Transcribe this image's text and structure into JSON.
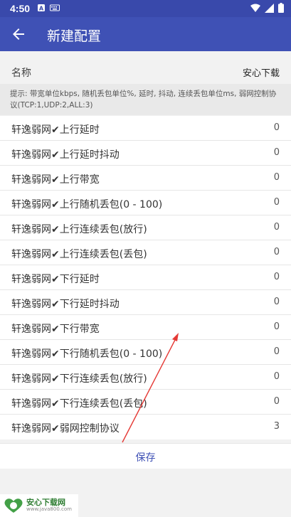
{
  "status": {
    "time": "4:50"
  },
  "appbar": {
    "title": "新建配置"
  },
  "name_row": {
    "label": "名称",
    "value": "安心下载"
  },
  "hint": "提示: 带宽单位kbps, 随机丢包单位%, 延时, 抖动, 连续丢包单位ms, 弱网控制协议(TCP:1,UDP:2,ALL:3)",
  "items": [
    {
      "label": "轩逸弱网✔上行延时",
      "value": "0"
    },
    {
      "label": "轩逸弱网✔上行延时抖动",
      "value": "0"
    },
    {
      "label": "轩逸弱网✔上行带宽",
      "value": "0"
    },
    {
      "label": "轩逸弱网✔上行随机丢包(0 - 100)",
      "value": "0"
    },
    {
      "label": "轩逸弱网✔上行连续丢包(放行)",
      "value": "0"
    },
    {
      "label": "轩逸弱网✔上行连续丢包(丢包)",
      "value": "0"
    },
    {
      "label": "轩逸弱网✔下行延时",
      "value": "0"
    },
    {
      "label": "轩逸弱网✔下行延时抖动",
      "value": "0"
    },
    {
      "label": "轩逸弱网✔下行带宽",
      "value": "0"
    },
    {
      "label": "轩逸弱网✔下行随机丢包(0 - 100)",
      "value": "0"
    },
    {
      "label": "轩逸弱网✔下行连续丢包(放行)",
      "value": "0"
    },
    {
      "label": "轩逸弱网✔下行连续丢包(丢包)",
      "value": "0"
    },
    {
      "label": "轩逸弱网✔弱网控制协议",
      "value": "3"
    }
  ],
  "save_label": "保存",
  "watermark": {
    "name": "安心下载网",
    "url": "www.java800.com"
  },
  "colors": {
    "appbar": "#3f51b5",
    "statusbar": "#3949ab",
    "accent": "#3f51b5",
    "arrow": "#e53935"
  },
  "icons": [
    "back-arrow-icon",
    "wifi-icon",
    "battery-icon",
    "notification-icon",
    "keyboard-icon"
  ]
}
